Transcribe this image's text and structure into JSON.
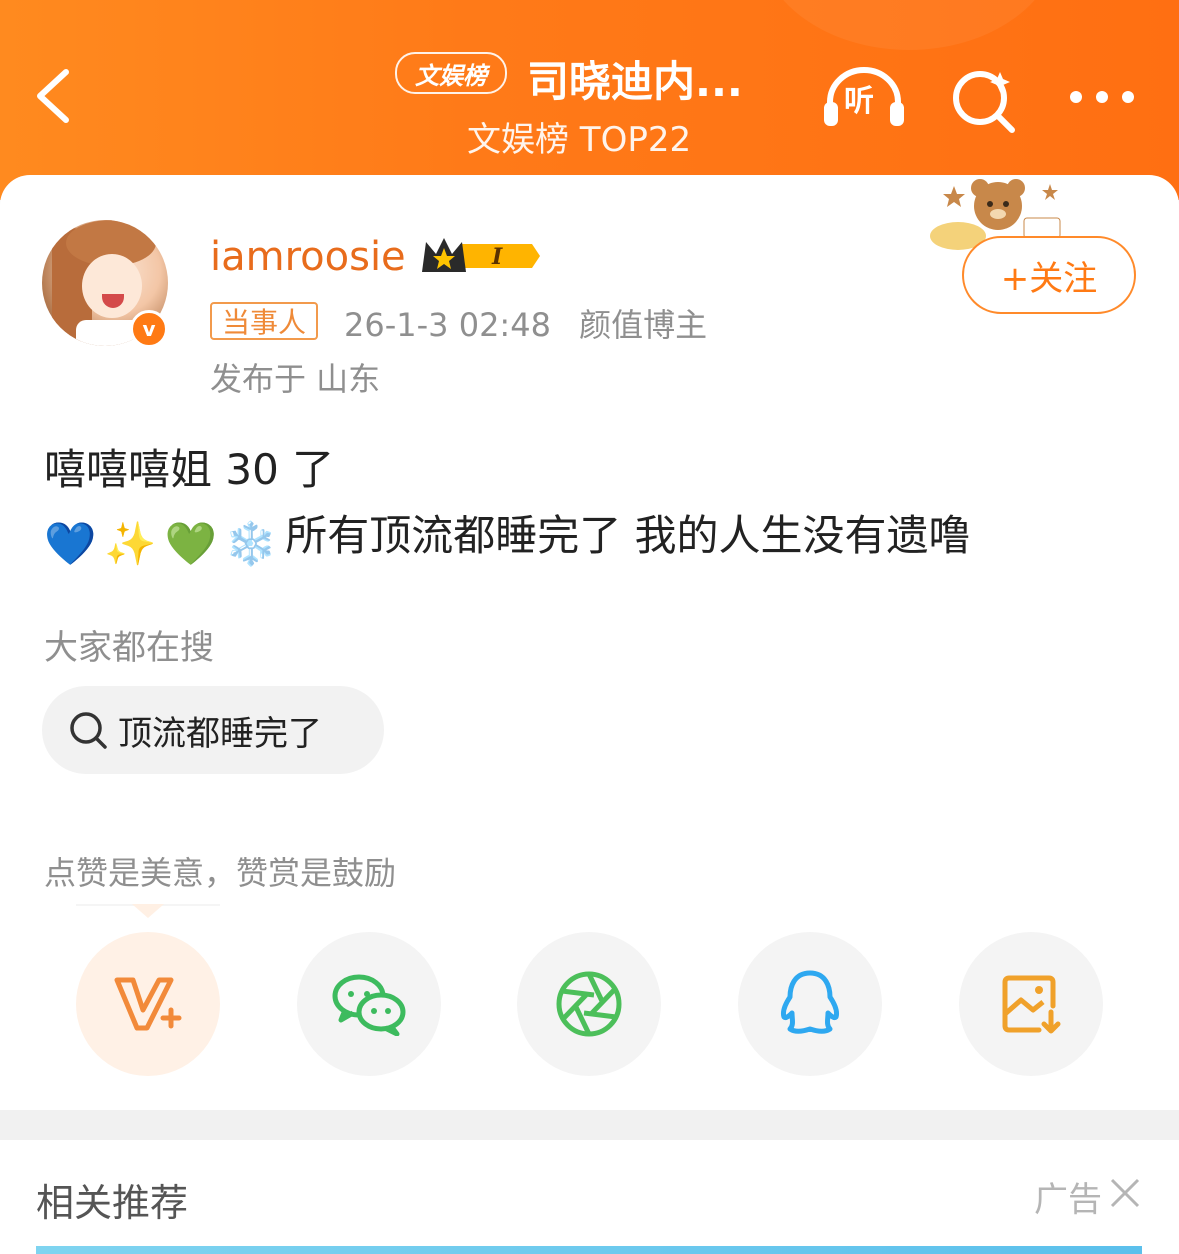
{
  "header": {
    "badge": "文娱榜",
    "title": "司晓迪内...",
    "subtitle": "文娱榜 TOP22",
    "listen_label": "听"
  },
  "post": {
    "username": "iamroosie",
    "role_tag": "当事人",
    "time": "26-1-3 02:48",
    "category": "颜值博主",
    "location": "发布于 山东",
    "follow_label": "+关注",
    "line1": "嘻嘻嘻姐 30 了",
    "line2_emoji": [
      "💙",
      "✨",
      "💚",
      "❄️"
    ],
    "line2_text": "所有顶流都睡完了 我的人生没有遗噜"
  },
  "search": {
    "section_label": "大家都在搜",
    "chip_text": "顶流都睡完了"
  },
  "reward": {
    "text": "点赞是美意，赞赏是鼓励"
  },
  "share_buttons": [
    {
      "icon": "v-plus-icon",
      "color": "#f28a3a"
    },
    {
      "icon": "wechat-icon",
      "color": "#3dbb5e"
    },
    {
      "icon": "moments-icon",
      "color": "#4cbf5a"
    },
    {
      "icon": "qq-icon",
      "color": "#2ea8f0"
    },
    {
      "icon": "save-image-icon",
      "color": "#f0a12a"
    }
  ],
  "recommend": {
    "title": "相关推荐",
    "ad_label": "广告"
  },
  "colors": {
    "header_bg": "#ff7a18",
    "accent": "#ff7a14",
    "username": "#e86c1c"
  }
}
